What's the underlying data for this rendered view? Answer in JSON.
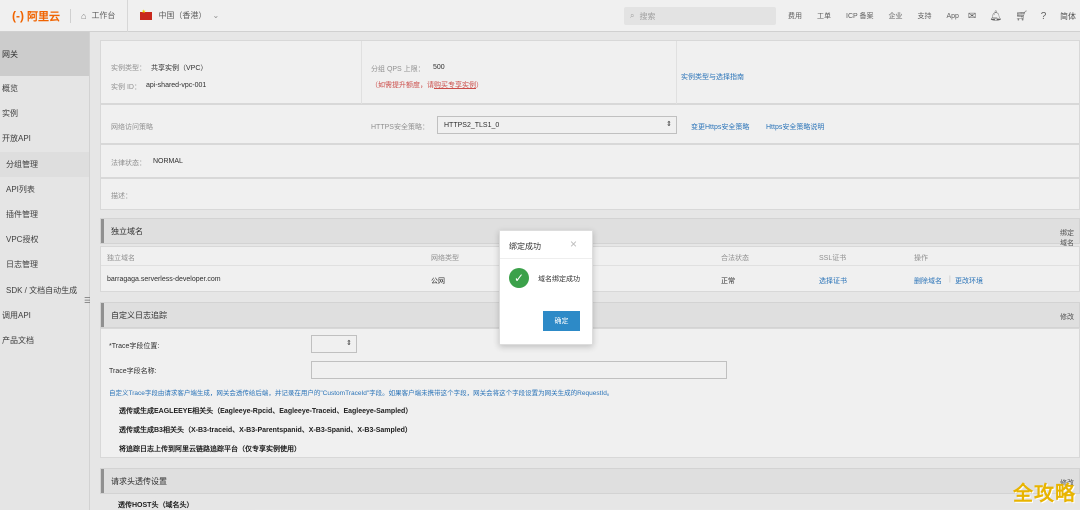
{
  "topbar": {
    "logo_text": "阿里云",
    "logo_mark": "(-)",
    "workbench": "工作台",
    "region": "中国（香港）",
    "search_placeholder": "搜索",
    "links": [
      "费用",
      "工单",
      "ICP 备案",
      "企业",
      "支持",
      "App"
    ],
    "lang": "简体"
  },
  "sidebar": {
    "title": "网关",
    "items": [
      {
        "label": "概览"
      },
      {
        "label": "实例"
      },
      {
        "label": "开放API"
      },
      {
        "label": "分组管理"
      },
      {
        "label": "API列表"
      },
      {
        "label": "插件管理"
      },
      {
        "label": "VPC授权"
      },
      {
        "label": "日志管理"
      },
      {
        "label": "SDK / 文档自动生成"
      },
      {
        "label": "调用API"
      },
      {
        "label": "产品文档"
      }
    ]
  },
  "instance": {
    "type_label": "实例类型：",
    "type_value": "共享实例（VPC）",
    "id_label": "实例 ID：",
    "id_value": "api-shared-vpc-001",
    "qps_label": "分组 QPS 上限：",
    "qps_value": "500",
    "qps_note_prefix": "（如需提升额度，请",
    "qps_note_link": "购买专享实例",
    "qps_note_suffix": "）",
    "type_link": "实例类型与选择指南"
  },
  "security": {
    "net_label": "网络访问策略",
    "https_label": "HTTPS安全策略：",
    "https_value": "HTTPS2_TLS1_0",
    "change_link": "变更Https安全策略",
    "desc_link": "Https安全策略说明"
  },
  "status": {
    "label": "法律状态：",
    "value": "NORMAL"
  },
  "description": {
    "label": "描述："
  },
  "domain_section": {
    "title": "独立域名",
    "right_link": "绑定域名",
    "headers": [
      "独立域名",
      "网络类型",
      "",
      "合法状态",
      "SSL证书",
      "操作"
    ],
    "rows": [
      {
        "domain": "barragaga.serverless-developer.com",
        "net": "公网",
        "legal": "正常",
        "ssl": "选择证书",
        "op_delete": "删除域名",
        "op_env": "更改环境"
      }
    ]
  },
  "log_section": {
    "title": "自定义日志追踪",
    "right_link": "修改",
    "trace_pos_label": "*Trace字段位置:",
    "trace_name_label": "Trace字段名称:",
    "desc": "自定义Trace字段由请求客户端生成，网关会透传给后端，并记录在用户的\"CustomTraceId\"字段。如果客户端未携带这个字段，网关会将这个字段设置为网关生成的RequestId。",
    "options": [
      "透传或生成EAGLEEYE相关头（Eagleeye-Rpcid、Eagleeye-Traceid、Eagleeye-Sampled）",
      "透传或生成B3相关头（X-B3-traceid、X-B3-Parentspanid、X-B3-Spanid、X-B3-Sampled）",
      "将追踪日志上传到阿里云链路追踪平台（仅专享实例使用）"
    ]
  },
  "header_section": {
    "title": "请求头透传设置",
    "right_link": "修改",
    "first_option": "透传HOST头（域名头）"
  },
  "modal": {
    "title": "绑定成功",
    "message": "域名绑定成功",
    "confirm": "确定"
  },
  "watermark": "全攻略"
}
